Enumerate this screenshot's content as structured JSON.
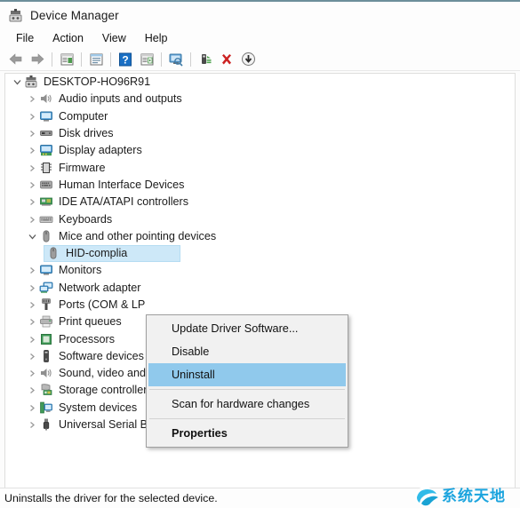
{
  "window": {
    "title": "Device Manager",
    "icon": "device-manager-icon"
  },
  "menubar": {
    "items": [
      {
        "label": "File"
      },
      {
        "label": "Action"
      },
      {
        "label": "View"
      },
      {
        "label": "Help"
      }
    ]
  },
  "toolbar": {
    "buttons": [
      {
        "icon": "back-arrow-icon",
        "name": "back-button"
      },
      {
        "icon": "forward-arrow-icon",
        "name": "forward-button"
      },
      {
        "icon": "separator",
        "name": "toolbar-separator-1"
      },
      {
        "icon": "show-hidden-panel-icon",
        "name": "properties-button"
      },
      {
        "icon": "separator",
        "name": "toolbar-separator-2"
      },
      {
        "icon": "list-panel-icon",
        "name": "view-panel-button"
      },
      {
        "icon": "separator",
        "name": "toolbar-separator-3"
      },
      {
        "icon": "help-icon",
        "name": "help-button"
      },
      {
        "icon": "play-panel-icon",
        "name": "update-driver-button"
      },
      {
        "icon": "separator",
        "name": "toolbar-separator-4"
      },
      {
        "icon": "monitor-search-icon",
        "name": "scan-monitor-button"
      },
      {
        "icon": "separator",
        "name": "toolbar-separator-5"
      },
      {
        "icon": "scan-hardware-icon",
        "name": "scan-hardware-button"
      },
      {
        "icon": "red-x-icon",
        "name": "uninstall-button"
      },
      {
        "icon": "down-arrow-circle-icon",
        "name": "disable-button"
      }
    ]
  },
  "tree": {
    "root": {
      "label": "DESKTOP-HO96R91",
      "icon": "computer-icon",
      "expanded": true
    },
    "nodes": [
      {
        "label": "Audio inputs and outputs",
        "icon": "speaker-icon",
        "level": 1,
        "expanded": false
      },
      {
        "label": "Computer",
        "icon": "monitor-icon",
        "level": 1,
        "expanded": false
      },
      {
        "label": "Disk drives",
        "icon": "disk-drive-icon",
        "level": 1,
        "expanded": false
      },
      {
        "label": "Display adapters",
        "icon": "display-adapter-icon",
        "level": 1,
        "expanded": false
      },
      {
        "label": "Firmware",
        "icon": "firmware-chip-icon",
        "level": 1,
        "expanded": false
      },
      {
        "label": "Human Interface Devices",
        "icon": "hid-icon",
        "level": 1,
        "expanded": false
      },
      {
        "label": "IDE ATA/ATAPI controllers",
        "icon": "ide-controller-icon",
        "level": 1,
        "expanded": false
      },
      {
        "label": "Keyboards",
        "icon": "keyboard-icon",
        "level": 1,
        "expanded": false
      },
      {
        "label": "Mice and other pointing devices",
        "icon": "mouse-icon",
        "level": 1,
        "expanded": true
      },
      {
        "label": "HID-complia",
        "icon": "mouse-icon",
        "level": 2,
        "selected": true
      },
      {
        "label": "Monitors",
        "icon": "monitor-icon",
        "level": 1,
        "expanded": false
      },
      {
        "label": "Network adapter",
        "icon": "network-icon",
        "level": 1,
        "expanded": false
      },
      {
        "label": "Ports (COM & LP",
        "icon": "port-icon",
        "level": 1,
        "expanded": false
      },
      {
        "label": "Print queues",
        "icon": "printer-icon",
        "level": 1,
        "expanded": false
      },
      {
        "label": "Processors",
        "icon": "processor-icon",
        "level": 1,
        "expanded": false
      },
      {
        "label": "Software devices",
        "icon": "software-device-icon",
        "level": 1,
        "expanded": false
      },
      {
        "label": "Sound, video and game controllers",
        "icon": "speaker-icon",
        "level": 1,
        "expanded": false
      },
      {
        "label": "Storage controllers",
        "icon": "storage-controller-icon",
        "level": 1,
        "expanded": false
      },
      {
        "label": "System devices",
        "icon": "system-device-icon",
        "level": 1,
        "expanded": false
      },
      {
        "label": "Universal Serial Bus controllers",
        "icon": "usb-icon",
        "level": 1,
        "expanded": false
      }
    ]
  },
  "context_menu": {
    "items": [
      {
        "label": "Update Driver Software...",
        "type": "item",
        "name": "ctx-update-driver"
      },
      {
        "label": "Disable",
        "type": "item",
        "name": "ctx-disable"
      },
      {
        "label": "Uninstall",
        "type": "item",
        "highlighted": true,
        "name": "ctx-uninstall"
      },
      {
        "type": "separator",
        "name": "ctx-separator-1"
      },
      {
        "label": "Scan for hardware changes",
        "type": "item",
        "name": "ctx-scan-hardware"
      },
      {
        "type": "separator",
        "name": "ctx-separator-2"
      },
      {
        "label": "Properties",
        "type": "item",
        "bold": true,
        "name": "ctx-properties"
      }
    ]
  },
  "statusbar": {
    "text": "Uninstalls the driver for the selected device."
  },
  "watermark": {
    "text": "系统天地"
  },
  "colors": {
    "selection": "#cde8f8",
    "menu_highlight": "#90c9ec",
    "accent": "#1ba4de",
    "title_border": "#6d8f9b"
  }
}
